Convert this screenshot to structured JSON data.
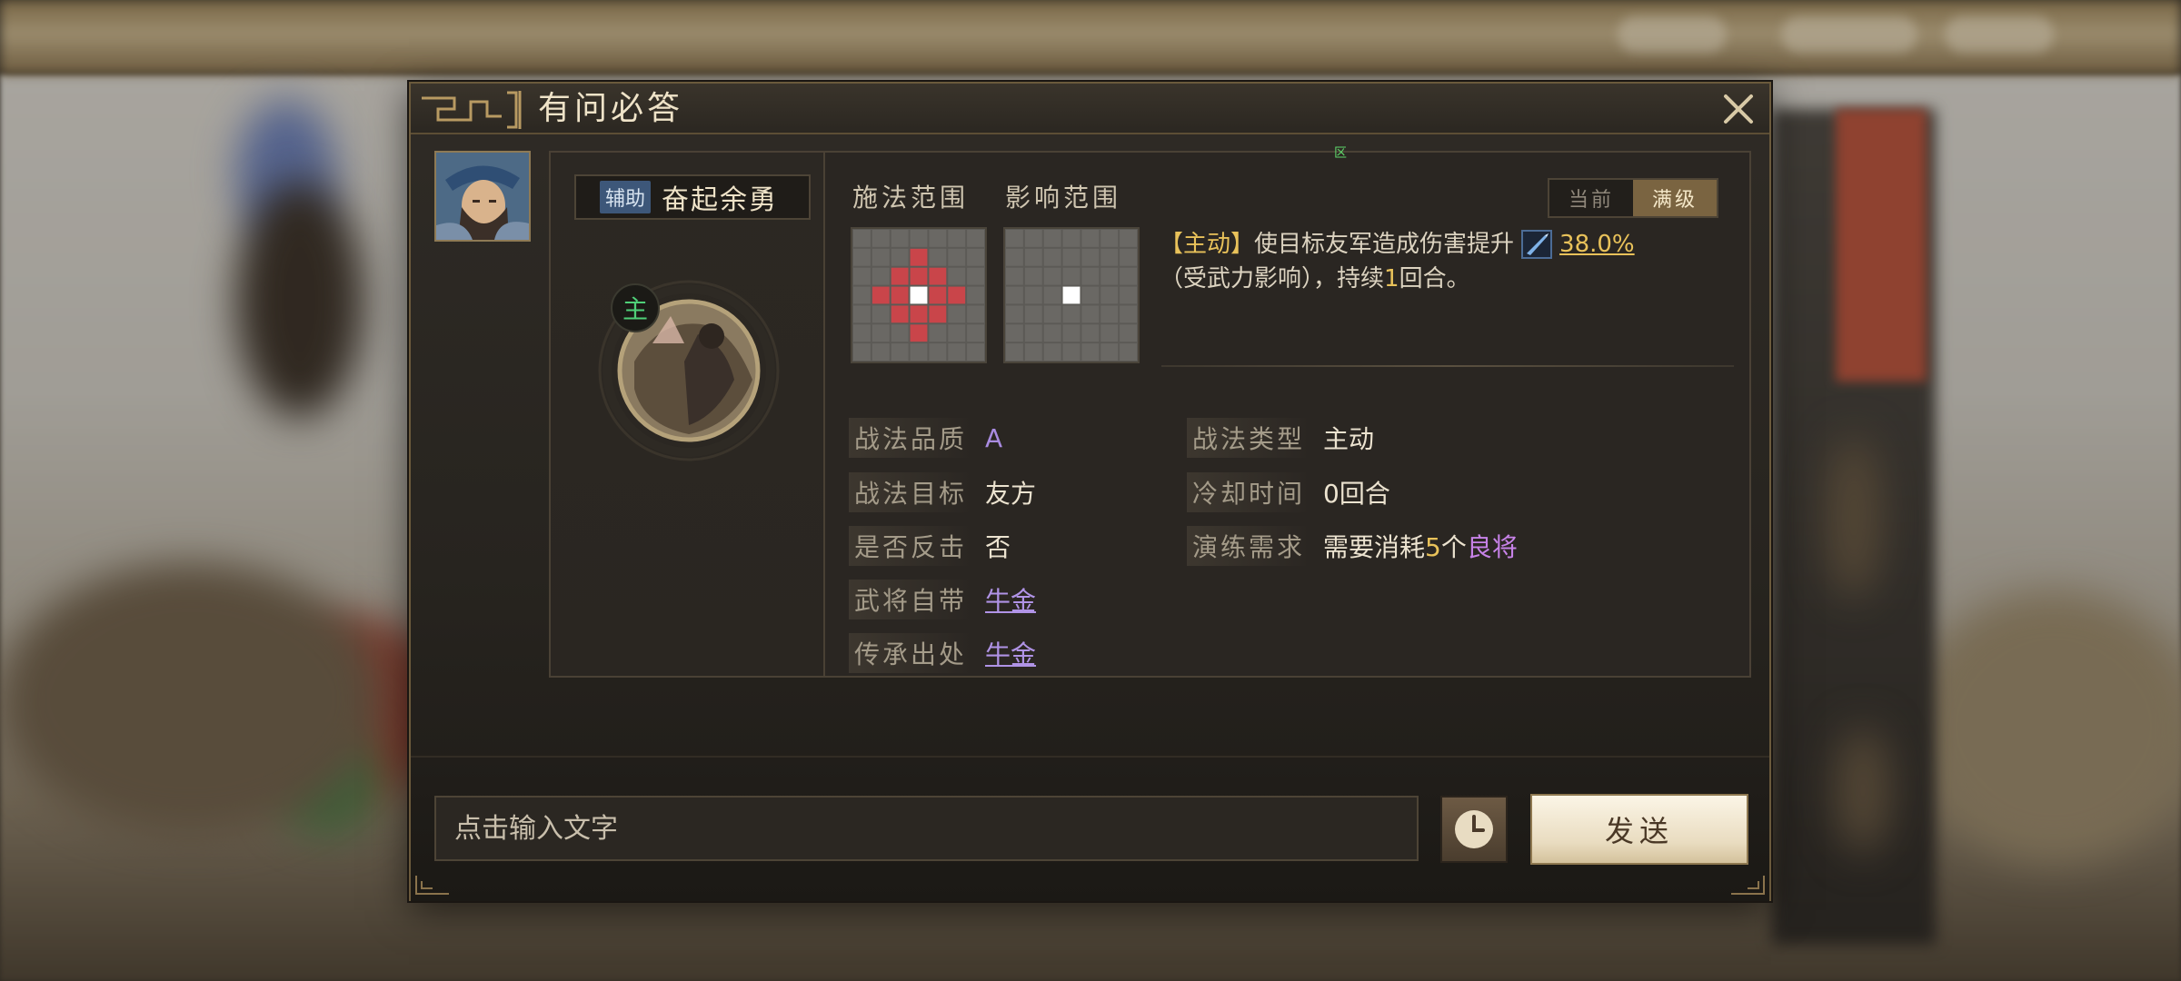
{
  "dialog": {
    "title": "有问必答",
    "close_icon": "close-icon"
  },
  "portrait": {
    "icon": "general-portrait"
  },
  "skill": {
    "type_tag": "辅助",
    "name": "奋起余勇",
    "icon": "skill-icon",
    "corner_glyph": "主"
  },
  "range": {
    "cast_label": "施法范围",
    "effect_label": "影响范围",
    "marker": "区"
  },
  "level_toggle": {
    "current": "当前",
    "max": "满级",
    "active": "max"
  },
  "description": {
    "tag": "【主动】",
    "text_before": "使目标友军造成伤害提升",
    "weapon_icon": "weapon-icon",
    "percent": "38.0%",
    "text_open": "（受武力影响），持续",
    "rounds": "1",
    "text_close": "回合。"
  },
  "attributes": {
    "quality": {
      "label": "战法品质",
      "value": "A"
    },
    "target": {
      "label": "战法目标",
      "value": "友方"
    },
    "counter": {
      "label": "是否反击",
      "value": "否"
    },
    "innate": {
      "label": "武将自带",
      "value": "牛金"
    },
    "inherit": {
      "label": "传承出处",
      "value": "牛金"
    },
    "skill_type": {
      "label": "战法类型",
      "value": "主动"
    },
    "cooldown": {
      "label": "冷却时间",
      "value": "0回合"
    },
    "training": {
      "label": "演练需求",
      "prefix": "需要消耗",
      "count": "5",
      "unit": "个",
      "link": "良将"
    }
  },
  "footer": {
    "input_placeholder": "点击输入文字",
    "input_value": "",
    "history_icon": "clock-icon",
    "send_label": "发送"
  },
  "colors": {
    "accent_gold": "#e9c25a",
    "grade_purple": "#a98be0",
    "link_purple": "#c782e8",
    "range_red": "#c9454a"
  }
}
